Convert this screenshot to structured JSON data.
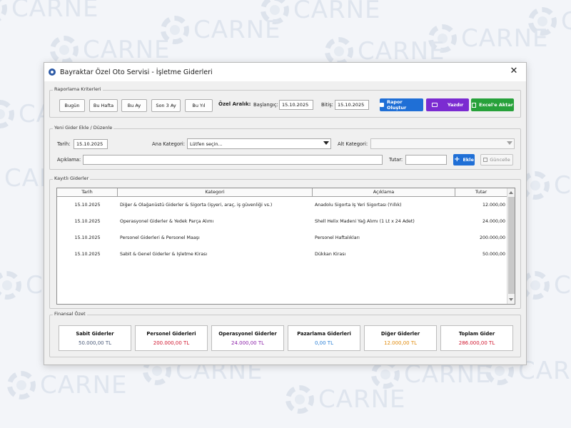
{
  "watermark": {
    "text": "CARNE"
  },
  "window": {
    "title": "Bayraktar Özel Oto Servisi - İşletme Giderleri",
    "close_glyph": "✕"
  },
  "report": {
    "legend": "Raporlama Kriterleri",
    "buttons": [
      "Bugün",
      "Bu Hafta",
      "Bu Ay",
      "Son 3 Ay",
      "Bu Yıl"
    ],
    "custom_range_label": "Özel Aralık:",
    "start_label": "Başlangıç:",
    "start_value": "15.10.2025",
    "end_label": "Bitiş:",
    "end_value": "15.10.2025",
    "create_report": "Rapor Oluştur",
    "print": "Yazdır",
    "export_excel": "Excel'e Aktar",
    "colors": {
      "create": "#1f6fd6",
      "print": "#7b2bd1",
      "excel": "#27a13a"
    }
  },
  "new_expense": {
    "legend": "Yeni Gider Ekle / Düzenle",
    "date_label": "Tarih:",
    "date_value": "15.10.2025",
    "main_category_label": "Ana Kategori:",
    "main_category_value": "Lütfen seçin...",
    "sub_category_label": "Alt Kategori:",
    "sub_category_value": "",
    "description_label": "Açıklama:",
    "description_value": "",
    "amount_label": "Tutar:",
    "amount_value": "",
    "add_label": "Ekle",
    "update_label": "Güncelle"
  },
  "expenses": {
    "legend": "Kayıtlı Giderler",
    "columns": [
      "Tarih",
      "Kategori",
      "Açıklama",
      "Tutar"
    ],
    "rows": [
      {
        "date": "15.10.2025",
        "category": "Diğer & Olağanüstü Giderler & Sigorta (işyeri, araç, iş güvenliği vs.)",
        "description": "Anadolu Sigorta İş Yeri Sigortası (Yıllık)",
        "amount": "12.000,00"
      },
      {
        "date": "15.10.2025",
        "category": "Operasyonel Giderler & Yedek Parça Alımı",
        "description": "Shell Helix Madeni Yağ Alımı (1 Lt x 24 Adet)",
        "amount": "24.000,00"
      },
      {
        "date": "15.10.2025",
        "category": "Personel Giderleri & Personel Maaşı",
        "description": "Personel Haftalıkları",
        "amount": "200.000,00"
      },
      {
        "date": "15.10.2025",
        "category": "Sabit & Genel Giderler & İşletme Kirası",
        "description": "Dükkan Kirası",
        "amount": "50.000,00"
      }
    ]
  },
  "summary": {
    "legend": "Finansal Özet",
    "cards": [
      {
        "title": "Sabit Giderler",
        "value": "50.000,00 TL",
        "color": "#4a5a78"
      },
      {
        "title": "Personel Giderleri",
        "value": "200.000,00 TL",
        "color": "#d0142c"
      },
      {
        "title": "Operasyonel Giderler",
        "value": "24.000,00 TL",
        "color": "#8a1fa8"
      },
      {
        "title": "Pazarlama Giderleri",
        "value": "0,00 TL",
        "color": "#2a7fd6"
      },
      {
        "title": "Diğer Giderler",
        "value": "12.000,00 TL",
        "color": "#e08a0a"
      },
      {
        "title": "Toplam Gider",
        "value": "286.000,00 TL",
        "color": "#d0142c"
      }
    ]
  }
}
